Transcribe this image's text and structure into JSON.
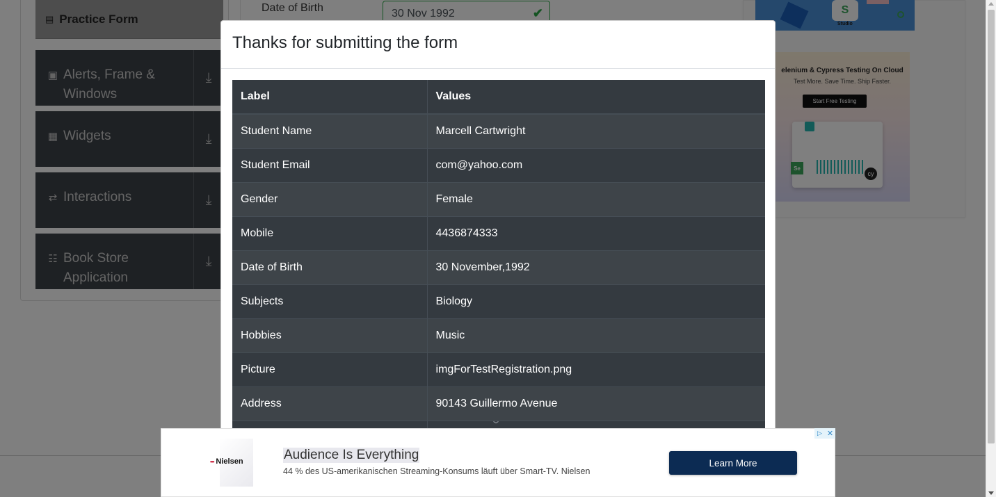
{
  "background": {
    "sidebar": {
      "practice_form": "Practice Form",
      "groups": [
        {
          "title_line1": "Alerts, Frame &",
          "title_line2": "Windows",
          "icon": "window-icon"
        },
        {
          "title_line1": "Widgets",
          "title_line2": "",
          "icon": "widgets-icon"
        },
        {
          "title_line1": "Interactions",
          "title_line2": "",
          "icon": "interactions-icon"
        },
        {
          "title_line1": "Book Store",
          "title_line2": "Application",
          "icon": "books-icon"
        }
      ]
    },
    "form": {
      "dob_label": "Date of Birth",
      "dob_value": "30 Nov 1992"
    },
    "side_ad": {
      "studio_logo": "S",
      "studio_label": "Studio",
      "headline": "elenium & Cypress Testing On Cloud",
      "tagline": "Test More. Save Time. Ship Faster.",
      "button": "Start Free Testing",
      "se_badge": "Se",
      "cy_badge": "cy"
    }
  },
  "modal": {
    "title": "Thanks for submitting the form",
    "table": {
      "headers": [
        "Label",
        "Values"
      ],
      "rows": [
        {
          "label": "Student Name",
          "value": "Marcell Cartwright"
        },
        {
          "label": "Student Email",
          "value": "com@yahoo.com"
        },
        {
          "label": "Gender",
          "value": "Female"
        },
        {
          "label": "Mobile",
          "value": "4436874333"
        },
        {
          "label": "Date of Birth",
          "value": "30 November,1992"
        },
        {
          "label": "Subjects",
          "value": "Biology"
        },
        {
          "label": "Hobbies",
          "value": "Music"
        },
        {
          "label": "Picture",
          "value": "imgForTestRegistration.png"
        },
        {
          "label": "Address",
          "value": "90143 Guillermo Avenue"
        }
      ]
    }
  },
  "bottom_ad": {
    "brand": "Nielsen",
    "headline": "Audience Is Everything",
    "subtext": "44 % des US-amerikanischen Streaming-Konsums läuft über Smart-TV. Nielsen",
    "cta": "Learn More",
    "adchoices_glyph": "▷",
    "close_glyph": "✕"
  },
  "colors": {
    "table_bg": "#343a40",
    "valid_green": "#28a745",
    "cta_bg": "#0c2b53",
    "sidebar_group_bg": "#3d4249"
  }
}
